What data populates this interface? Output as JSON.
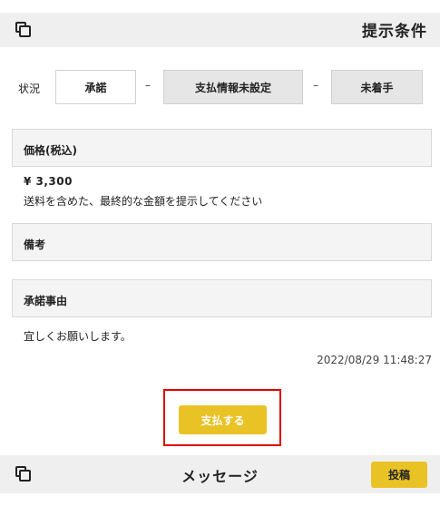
{
  "header": {
    "title": "提示条件",
    "icon": "copy-icon"
  },
  "status": {
    "label": "状況",
    "steps": [
      "承諾",
      "支払情報未設定",
      "未着手"
    ],
    "separator": "–"
  },
  "price": {
    "heading": "価格(税込)",
    "value": "¥ 3,300",
    "note": "送料を含めた、最終的な金額を提示してください"
  },
  "remarks": {
    "heading": "備考"
  },
  "reason": {
    "heading": "承諾事由",
    "text": "宜しくお願いします。",
    "timestamp": "2022/08/29 11:48:27"
  },
  "actions": {
    "pay_label": "支払する"
  },
  "footer": {
    "title": "メッセージ",
    "post_label": "投稿",
    "icon": "copy-icon"
  },
  "colors": {
    "accent": "#e9c226",
    "highlight": "#e00000",
    "header_bg": "#efefef"
  }
}
